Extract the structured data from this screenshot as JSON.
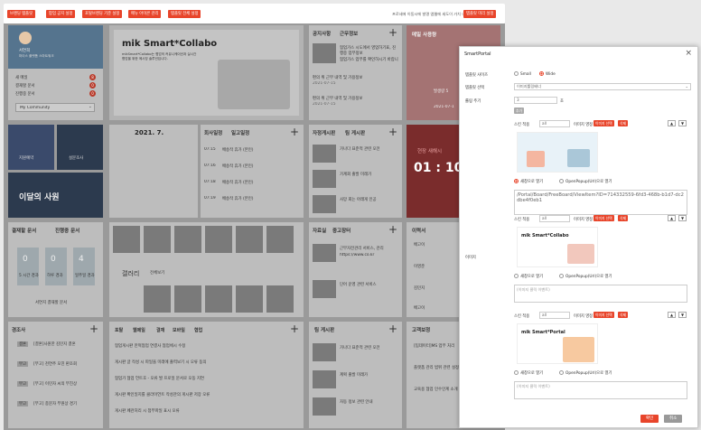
{
  "topbar": {
    "buttons": [
      "브랜딩 템플릿",
      "팝업 공지 설정",
      "포탈브랜딩 기준 설정",
      "메뉴 아이콘 관리",
      "템플릿 전체 설정"
    ],
    "notice": "프로세에 이동시에 발명 앱웹에 세도이 가치 내가 분야를 완료합니다.",
    "right_button": "템플릿 미리 설정"
  },
  "profile": {
    "name": "서연희",
    "dept": "마이스 플랫폼 스마트워크",
    "items": [
      {
        "label": "새 메일",
        "count": "8"
      },
      {
        "label": "결재할 문서",
        "count": "0"
      },
      {
        "label": "진행중 문서",
        "count": "0"
      }
    ],
    "select": "My Community"
  },
  "banner": {
    "title": "mik Smart*Collabo",
    "sub": "mikSmart*Collabo는 협업의 커뮤니케이션과 실시간 협업을 위한 메시징 솔루션입니다."
  },
  "notice_card": {
    "tabs": [
      "공지사항",
      "근무정보"
    ],
    "items": [
      "협업가스 시도에서 영업하기표, 진행중 업무정보",
      "협업가스 업무를 확인하시기 바랍니다.",
      "편의 위 근무 내역 및 가용정보",
      "편의 위 근무 내역 및 가용정보"
    ],
    "dates": [
      "2021-07-15",
      "2021-07-15",
      "2021-07-15"
    ]
  },
  "mail_card": {
    "title": "메일 사용량",
    "label": "발생량 5",
    "date": "2021-07-1"
  },
  "quick": {
    "labels": [
      "지원예약",
      "설문조사"
    ],
    "employee": "이달의 사원"
  },
  "calendar": {
    "title": "2021. 7."
  },
  "schedule": {
    "tabs": [
      "회사일정",
      "일고일정"
    ],
    "items": [
      {
        "t": "07:15",
        "s": "배송작 휴가 (본인)"
      },
      {
        "t": "07:16",
        "s": "배송작 휴가 (본인)"
      },
      {
        "t": "07:18",
        "s": "배송작 휴가 (본인)"
      },
      {
        "t": "07:19",
        "s": "배송작 휴가 (본인)"
      }
    ]
  },
  "board": {
    "tabs": [
      "자정게시판",
      "팀 게시판"
    ],
    "items": [
      "가나다 표준적 관련 오전",
      "가계회 출발 미래가",
      "사망 회는 아래게 인공"
    ]
  },
  "clock": {
    "title": "현장 새해시",
    "time": "01 : 10"
  },
  "approval": {
    "tabs": [
      "결재할 문서",
      "진행중 문서"
    ],
    "boxes": [
      {
        "n": "0",
        "u": "건",
        "l": "5 시간 경과"
      },
      {
        "n": "0",
        "u": "건",
        "l": "하루 경과"
      },
      {
        "n": "4",
        "u": "건",
        "l": "일주일 경과"
      }
    ],
    "foot": "서연지 결재할 문서"
  },
  "gallery": {
    "label": "갤러리",
    "more": "전체보기"
  },
  "data_room": {
    "tabs": [
      "자료실",
      "중고장터"
    ],
    "items": [
      "근무자전관리 서비스, 관리",
      "https://www.co.kr",
      "단어 운영 관련 서비스"
    ]
  },
  "lease": {
    "title": "이력서",
    "names": [
      "배고이",
      "이영준",
      "김민지",
      "배고이"
    ]
  },
  "ceo": {
    "title": "경조사",
    "items": [
      {
        "tag": "결혼",
        "s": "[결혼]사원한 김민지 결혼"
      },
      {
        "tag": "부고",
        "s": "[부고] 천연주 모친 판조회"
      },
      {
        "tag": "부고",
        "s": "[부고] 이민자 씨의 부친상"
      },
      {
        "tag": "부고",
        "s": "[부고] 종문자 부원상 경기"
      }
    ]
  },
  "recent": {
    "tabs": [
      "포탈",
      "웹메일",
      "결재",
      "모바일",
      "협업"
    ],
    "rows": [
      "협업게시판 만혁협업 연결사 협업체시 수정",
      "게시판 글 작성 시 파일을 미래에 출력보기 시 오류 동의",
      "협업가 협업 언트호 - 오류 발 프로일 문서로 오동 지연",
      "게시판 확인일지를 클라이언트 작성관의 게시판 저장 오류",
      "게시판 페관처리 시 첨부파일 표시 오류"
    ]
  },
  "team_board": {
    "title": "팀 게시판",
    "items": [
      "가나다 표준적 관련 오전",
      "계획 출발 미래가",
      "자동 정보 관련 안내"
    ]
  },
  "notice2": {
    "title": "고객보정",
    "items": [
      "[팀데이터]MS 업무 처리",
      "플랫폼 관리 범위 관련 설정",
      "교육용 협업 인수인계 소개"
    ]
  },
  "modal": {
    "title": "SmartPortal",
    "labels": {
      "template": "템플릿 사이즈",
      "select": "템플릿 선택",
      "roll": "롤링 주기",
      "image": "이미지"
    },
    "size_opts": [
      "Small",
      "Wide"
    ],
    "size_selected": "Wide",
    "select_value": "이미지롤링배너",
    "roll_value": "3",
    "roll_unit": "초",
    "add_label": "추가",
    "slot_label": "스킨 적용",
    "slot_sel": "all",
    "slot_mid": "이미지 영정",
    "slot_up": "이미지 선택",
    "slot_del": "삭제",
    "link_new": "새창으로 열기",
    "link_popup": "OpenPopup(Url)으로 열기",
    "url": "/Portal/Board/FreeBoard/ViewItem?ID=714332559-6fd3-468b-b1d7-dc2dbe4f0eb1",
    "url_placeholder": "(이미지 클릭 이벤트)",
    "ok": "확인",
    "cancel": "취소"
  }
}
